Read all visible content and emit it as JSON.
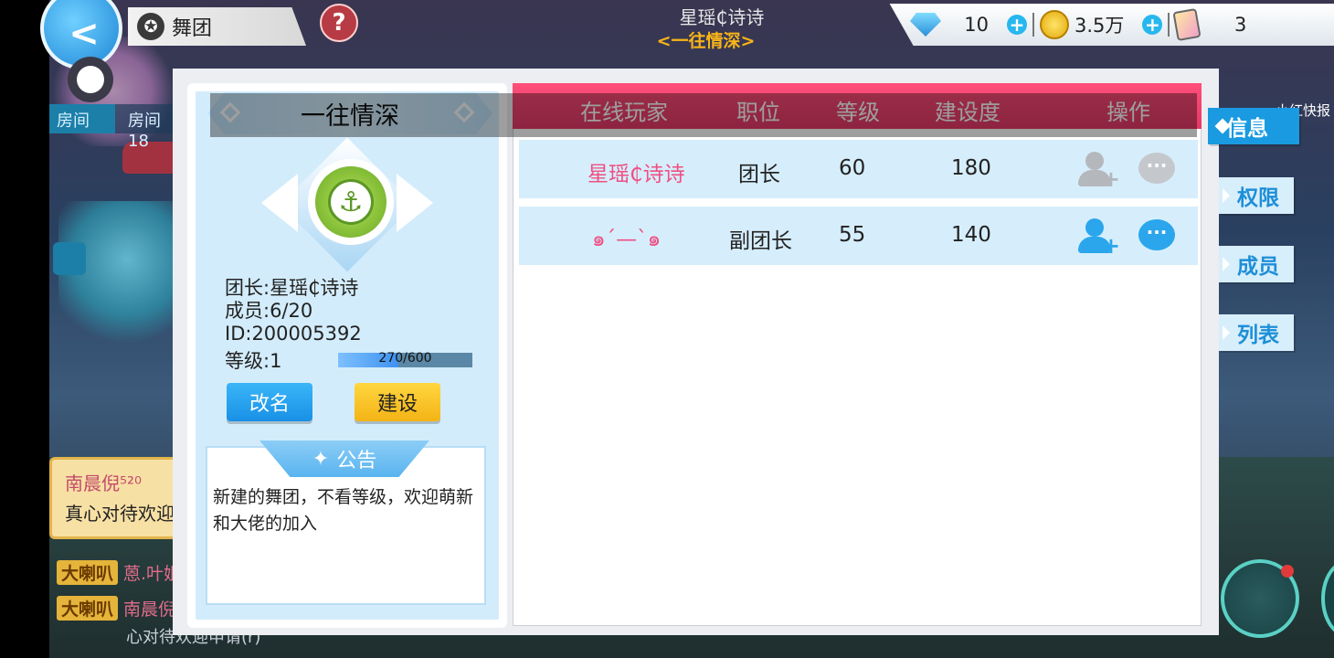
{
  "topbar": {
    "back_icon": "chevron-left-icon",
    "section_label": "舞团",
    "section_label_shadow": "舞",
    "help_label": "?",
    "player_name": "星瑶₵诗诗",
    "group_name": "<一往情深>",
    "currency": {
      "gems": "10",
      "coins": "3.5万",
      "cards": "3"
    }
  },
  "chat": {
    "room_tab": "房间",
    "room_tab2": "房间18",
    "notice_name": "南晨倪⁵²⁰",
    "notice_msg": "真心对待欢迎",
    "lines": [
      {
        "badge": "大喇叭",
        "who": "蒽.叶姐"
      },
      {
        "badge": "大喇叭",
        "who": "南晨倪"
      }
    ],
    "tail": "心对待欢迎申请(r)"
  },
  "group_panel": {
    "title": "一往情深",
    "leader": "团长:星瑶₵诗诗",
    "members": "成员:6/20",
    "id": "ID:200005392",
    "level": "等级:1",
    "exp_text": "270/600",
    "exp_current": 270,
    "exp_max": 600,
    "rename_label": "改名",
    "build_label": "建设",
    "notice_title": "公告",
    "notice_text": "新建的舞团，不看等级，欢迎萌新和大佬的加入"
  },
  "table": {
    "headers": [
      "在线玩家",
      "职位",
      "等级",
      "建设度",
      "操作"
    ],
    "rows": [
      {
        "name": "星瑶₵诗诗",
        "name_color": "#ef4f82",
        "role": "团长",
        "level": "60",
        "build": "180",
        "actions_state": "gray"
      },
      {
        "name": "๑ˊ—ˋ๑",
        "name_color": "#ef4f82",
        "role": "副团长",
        "level": "55",
        "build": "140",
        "actions_state": "blue"
      }
    ]
  },
  "side_menu": {
    "items": [
      "信息",
      "权限",
      "成员",
      "列表"
    ],
    "active": "信息",
    "news_label": "小红快报"
  },
  "colors": {
    "header_pink": "#ea4070",
    "accent_blue": "#1a9ae0",
    "row_bg": "#d6eefc",
    "build_yellow": "#f7c226"
  }
}
